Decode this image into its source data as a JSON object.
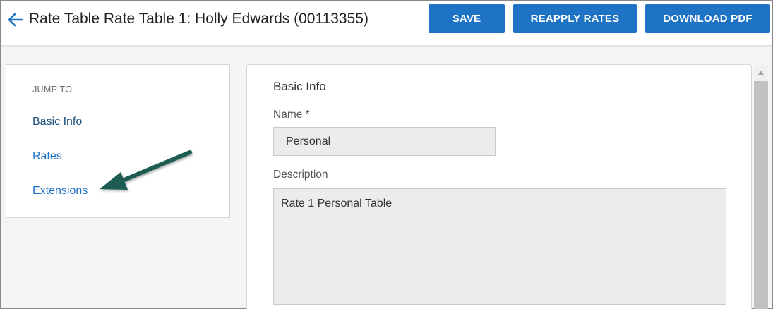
{
  "header": {
    "title": "Rate Table Rate Table 1: Holly Edwards (00113355)",
    "save_label": "SAVE",
    "reapply_label": "REAPPLY RATES",
    "download_label": "DOWNLOAD PDF"
  },
  "jump_to": {
    "heading": "JUMP TO",
    "items": [
      {
        "label": "Basic Info"
      },
      {
        "label": "Rates"
      },
      {
        "label": "Extensions"
      }
    ]
  },
  "basic_info": {
    "section_title": "Basic Info",
    "name_label": "Name *",
    "name_value": "Personal",
    "description_label": "Description",
    "description_value": "Rate 1 Personal Table"
  },
  "colors": {
    "accent": "#1f73c4",
    "annotation_arrow": "#1a5c52"
  }
}
